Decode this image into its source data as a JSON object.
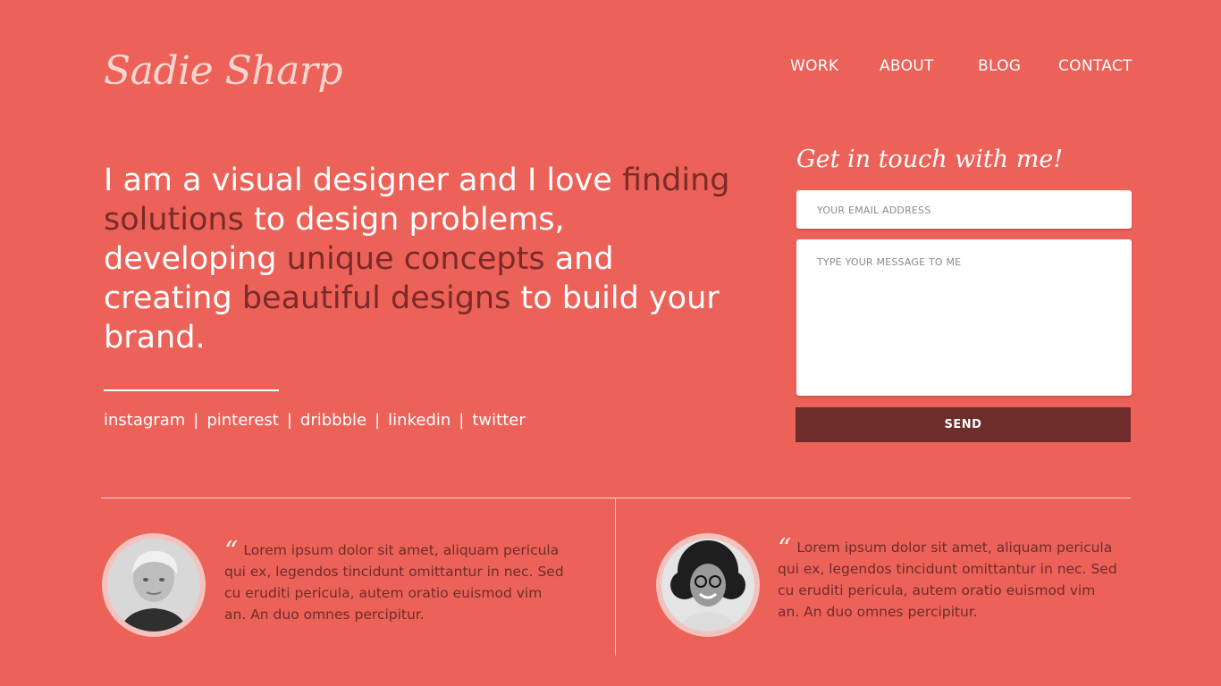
{
  "brand": {
    "name": "Sadie Sharp"
  },
  "nav": {
    "items": [
      {
        "label": "WORK"
      },
      {
        "label": "ABOUT"
      },
      {
        "label": "BLOG"
      },
      {
        "label": "CONTACT"
      }
    ]
  },
  "hero": {
    "segments": [
      {
        "text": "I am a visual designer and I love ",
        "highlight": false
      },
      {
        "text": "finding solutions",
        "highlight": true
      },
      {
        "text": " to design problems, developing ",
        "highlight": false
      },
      {
        "text": "unique concepts",
        "highlight": true
      },
      {
        "text": " and creating ",
        "highlight": false
      },
      {
        "text": "beautiful designs",
        "highlight": true
      },
      {
        "text": " to build your brand.",
        "highlight": false
      }
    ]
  },
  "social": {
    "links": [
      "instagram",
      "pinterest",
      "dribbble",
      "linkedin",
      "twitter"
    ],
    "separator": "|"
  },
  "contact": {
    "title": "Get in touch with me!",
    "email_placeholder": "YOUR EMAIL ADDRESS",
    "message_placeholder": "TYPE YOUR MESSAGE TO ME",
    "send_label": "SEND"
  },
  "testimonials": [
    {
      "quote_mark": "“",
      "text": "Lorem ipsum dolor sit amet, aliquam pericula qui ex, legendos tincidunt omittantur in nec. Sed cu eruditi pericula, autem oratio euismod vim an. An duo omnes percipitur."
    },
    {
      "quote_mark": "“",
      "text": "Lorem ipsum dolor sit amet, aliquam pericula qui ex, legendos tincidunt omittantur in nec. Sed cu eruditi pericula, autem oratio euismod vim an. An duo omnes percipitur."
    }
  ],
  "colors": {
    "background": "#ec6259",
    "accent_dark": "#6e2c2a",
    "highlight_text": "#7a2b28",
    "white": "#ffffff"
  }
}
